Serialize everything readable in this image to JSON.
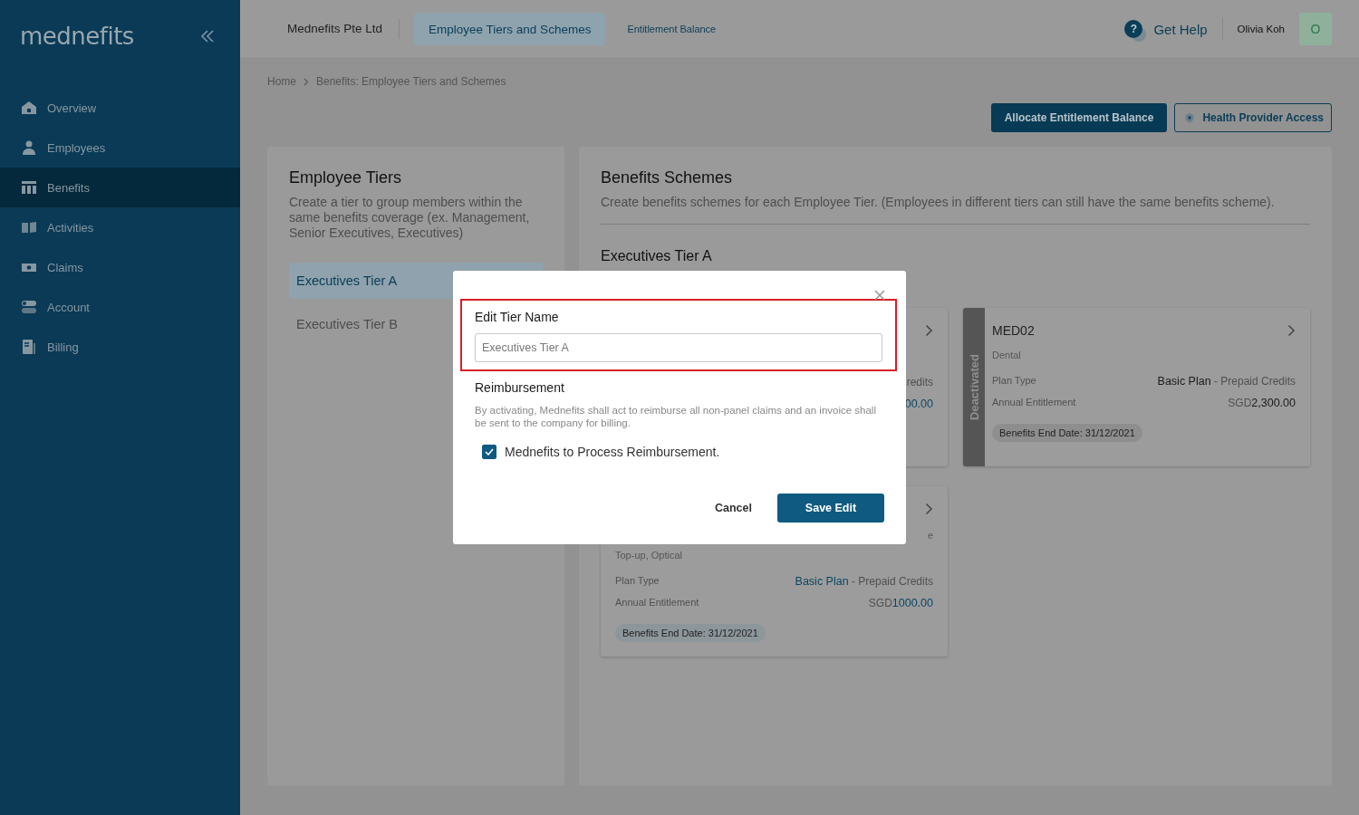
{
  "sidebar": {
    "logo": "mednefits",
    "items": [
      {
        "label": "Overview",
        "selected": false
      },
      {
        "label": "Employees",
        "selected": false
      },
      {
        "label": "Benefits",
        "selected": true
      },
      {
        "label": "Activities",
        "selected": false
      },
      {
        "label": "Claims",
        "selected": false
      },
      {
        "label": "Account",
        "selected": false
      },
      {
        "label": "Billing",
        "selected": false
      }
    ]
  },
  "header": {
    "company": "Mednefits Pte Ltd",
    "tabs": [
      {
        "label": "Employee Tiers and Schemes",
        "selected": true
      },
      {
        "label": "Entitlement Balance",
        "selected": false
      }
    ],
    "help": "Get Help",
    "help_badge": "?",
    "user": "Olivia Koh",
    "avatar": "O"
  },
  "breadcrumb": [
    "Home",
    "Benefits: Employee Tiers and Schemes"
  ],
  "actions": [
    {
      "label": "Allocate Entitlement Balance",
      "kind": "primary"
    },
    {
      "label": "Health Provider Access",
      "kind": "outline"
    }
  ],
  "tiers_panel": {
    "title": "Employee Tiers",
    "description": "Create a tier to group members within the same benefits coverage (ex. Management, Senior Executives, Executives)",
    "tiers": [
      {
        "label": "Executives Tier A",
        "selected": true
      },
      {
        "label": "Executives Tier B",
        "selected": false
      }
    ]
  },
  "schemes_panel": {
    "title": "Benefits Schemes",
    "description": "Create benefits schemes for each Employee Tier. (Employees in different tiers can still have the same benefits scheme).",
    "tier_title": "Executives Tier A",
    "cards": [
      {
        "deactivated": false,
        "rows": [
          {
            "rest": "redits"
          },
          {
            "emph": "00.00"
          }
        ]
      },
      {
        "deactivated": true,
        "status_label": "Deactivated",
        "name": "MED02",
        "category": "Dental",
        "rows": [
          {
            "label": "Plan Type",
            "emph": "Basic Plan",
            "rest": " - Prepaid Credits"
          },
          {
            "label": "Annual Entitlement",
            "prefix": "SGD",
            "emph": "2,300.00"
          }
        ],
        "end_date": "Benefits End Date: 31/12/2021"
      },
      {
        "deactivated": false,
        "note": "e",
        "category": "Top-up, Optical",
        "rows": [
          {
            "label": "Plan Type",
            "emph": "Basic Plan",
            "rest": " - Prepaid Credits"
          },
          {
            "label": "Annual Entitlement",
            "prefix": "SGD",
            "emph": "1000.00"
          }
        ],
        "end_date": "Benefits End Date: 31/12/2021"
      }
    ]
  },
  "modal": {
    "title": "Edit Tier Name",
    "highlighted": true,
    "input": {
      "value": "Executives Tier A"
    },
    "section_title": "Reimbursement",
    "section_text": "By activating, Mednefits shall act to reimburse all non-panel claims and an invoice shall be sent to the company for billing.",
    "checkbox": {
      "label": "Mednefits to Process Reimbursement.",
      "checked": true
    },
    "buttons": [
      {
        "label": "Cancel",
        "kind": "text"
      },
      {
        "label": "Save Edit",
        "kind": "primary"
      }
    ]
  }
}
